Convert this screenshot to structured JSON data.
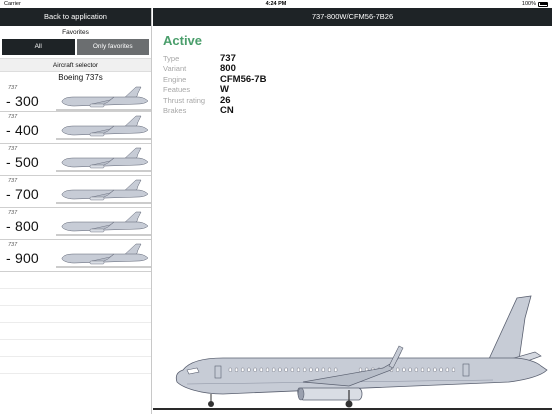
{
  "status_bar": {
    "carrier": "Carrier",
    "time": "4:24 PM",
    "battery": "100%"
  },
  "sidebar": {
    "back_label": "Back to application",
    "favorites_label": "Favorites",
    "seg_all": "All",
    "seg_only": "Only favorites",
    "selector_header": "Aircraft selector",
    "group": "Boeing 737s",
    "aircraft": [
      {
        "family": "737",
        "variant": "- 300"
      },
      {
        "family": "737",
        "variant": "- 400"
      },
      {
        "family": "737",
        "variant": "- 500"
      },
      {
        "family": "737",
        "variant": "- 700"
      },
      {
        "family": "737",
        "variant": "- 800"
      },
      {
        "family": "737",
        "variant": "- 900"
      }
    ]
  },
  "header": {
    "title": "737-800W/CFM56-7B26"
  },
  "detail": {
    "status": "Active",
    "specs": [
      {
        "key": "Type",
        "value": "737"
      },
      {
        "key": "Variant",
        "value": "800"
      },
      {
        "key": "Engine",
        "value": "CFM56-7B"
      },
      {
        "key": "Featues",
        "value": "W"
      },
      {
        "key": "Thrust rating",
        "value": "26"
      },
      {
        "key": "Brakes",
        "value": "CN"
      }
    ]
  },
  "colors": {
    "dark": "#1e2326",
    "accent": "#4a9e6b",
    "segment_inactive": "#6b6e70",
    "plane_fill": "#c7ccd6",
    "plane_stroke": "#5a6070"
  },
  "icons": {
    "plane": "aircraft-side-view-icon",
    "wifi": "wifi-icon",
    "battery": "battery-icon"
  }
}
